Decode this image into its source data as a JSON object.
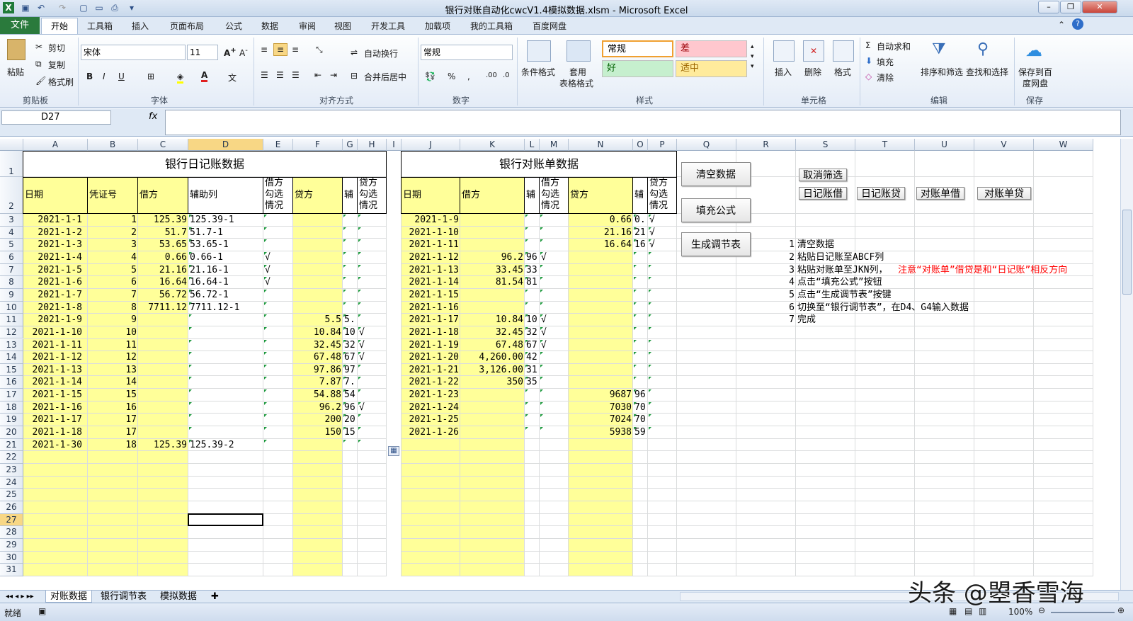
{
  "window": {
    "title": "银行对账自动化cwcV1.4模拟数据.xlsm - Microsoft Excel"
  },
  "quick_access": [
    "save-icon",
    "undo-icon",
    "redo-icon",
    "new-icon",
    "open-icon",
    "print-preview-icon"
  ],
  "tabs": {
    "file": "文件",
    "items": [
      "开始",
      "工具箱",
      "插入",
      "页面布局",
      "公式",
      "数据",
      "审阅",
      "视图",
      "开发工具",
      "加载项",
      "我的工具箱",
      "百度网盘"
    ]
  },
  "ribbon": {
    "clipboard": {
      "paste": "粘贴",
      "cut": "剪切",
      "copy": "复制",
      "format_painter": "格式刷",
      "label": "剪贴板"
    },
    "font": {
      "name": "宋体",
      "size": "11",
      "label": "字体"
    },
    "alignment": {
      "wrap": "自动换行",
      "merge": "合并后居中",
      "label": "对齐方式"
    },
    "number": {
      "format": "常规",
      "label": "数字"
    },
    "styles": {
      "conditional": "条件格式",
      "table": "套用",
      "table2": "表格格式",
      "normal": "常规",
      "bad": "差",
      "good": "好",
      "neutral": "适中",
      "label": "样式"
    },
    "cells": {
      "insert": "插入",
      "delete": "删除",
      "format": "格式",
      "label": "单元格"
    },
    "editing": {
      "autosum": "自动求和",
      "fill": "填充",
      "clear": "清除",
      "sort": "排序和筛选",
      "find": "查找和选择",
      "label": "编辑"
    },
    "save": {
      "button": "保存到百",
      "button2": "度网盘",
      "label": "保存"
    }
  },
  "formula_bar": {
    "name_box": "D27",
    "fx": "fx",
    "formula": ""
  },
  "columns": [
    "A",
    "B",
    "C",
    "D",
    "E",
    "F",
    "G",
    "H",
    "I",
    "J",
    "K",
    "L",
    "M",
    "N",
    "O",
    "P",
    "Q",
    "R",
    "S",
    "T",
    "U",
    "V",
    "W"
  ],
  "rows": [
    "1",
    "2",
    "3",
    "4",
    "5",
    "6",
    "7",
    "8",
    "9",
    "10",
    "11",
    "12",
    "13",
    "14",
    "15",
    "16",
    "17",
    "18",
    "19",
    "20",
    "21",
    "22",
    "23",
    "24",
    "25",
    "26",
    "27",
    "28",
    "29",
    "30",
    "31"
  ],
  "journal": {
    "title": "银行日记账数据",
    "headers": {
      "date": "日期",
      "voucher": "凭证号",
      "debit": "借方",
      "aux": "辅助列",
      "debit_check": "借方勾选情况",
      "credit": "贷方",
      "aux2": "辅",
      "credit_check": "贷方勾选情况"
    },
    "rows": [
      {
        "date": "2021-1-1",
        "voucher": "1",
        "debit": "125.39",
        "aux": "125.39-1",
        "dchk": "",
        "credit": "",
        "aux2": "",
        "cchk": ""
      },
      {
        "date": "2021-1-2",
        "voucher": "2",
        "debit": "51.7",
        "aux": "51.7-1",
        "dchk": "",
        "credit": "",
        "aux2": "",
        "cchk": ""
      },
      {
        "date": "2021-1-3",
        "voucher": "3",
        "debit": "53.65",
        "aux": "53.65-1",
        "dchk": "",
        "credit": "",
        "aux2": "",
        "cchk": ""
      },
      {
        "date": "2021-1-4",
        "voucher": "4",
        "debit": "0.66",
        "aux": "0.66-1",
        "dchk": "√",
        "credit": "",
        "aux2": "",
        "cchk": ""
      },
      {
        "date": "2021-1-5",
        "voucher": "5",
        "debit": "21.16",
        "aux": "21.16-1",
        "dchk": "√",
        "credit": "",
        "aux2": "",
        "cchk": ""
      },
      {
        "date": "2021-1-6",
        "voucher": "6",
        "debit": "16.64",
        "aux": "16.64-1",
        "dchk": "√",
        "credit": "",
        "aux2": "",
        "cchk": ""
      },
      {
        "date": "2021-1-7",
        "voucher": "7",
        "debit": "56.72",
        "aux": "56.72-1",
        "dchk": "",
        "credit": "",
        "aux2": "",
        "cchk": ""
      },
      {
        "date": "2021-1-8",
        "voucher": "8",
        "debit": "7711.12",
        "aux": "7711.12-1",
        "dchk": "",
        "credit": "",
        "aux2": "",
        "cchk": ""
      },
      {
        "date": "2021-1-9",
        "voucher": "9",
        "debit": "",
        "aux": "",
        "dchk": "",
        "credit": "5.5",
        "aux2": "5.",
        "cchk": ""
      },
      {
        "date": "2021-1-10",
        "voucher": "10",
        "debit": "",
        "aux": "",
        "dchk": "",
        "credit": "10.84",
        "aux2": "10.",
        "cchk": "√"
      },
      {
        "date": "2021-1-11",
        "voucher": "11",
        "debit": "",
        "aux": "",
        "dchk": "",
        "credit": "32.45",
        "aux2": "32.",
        "cchk": "√"
      },
      {
        "date": "2021-1-12",
        "voucher": "12",
        "debit": "",
        "aux": "",
        "dchk": "",
        "credit": "67.48",
        "aux2": "67.",
        "cchk": "√"
      },
      {
        "date": "2021-1-13",
        "voucher": "13",
        "debit": "",
        "aux": "",
        "dchk": "",
        "credit": "97.86",
        "aux2": "97.",
        "cchk": ""
      },
      {
        "date": "2021-1-14",
        "voucher": "14",
        "debit": "",
        "aux": "",
        "dchk": "",
        "credit": "7.87",
        "aux2": "7.",
        "cchk": ""
      },
      {
        "date": "2021-1-15",
        "voucher": "15",
        "debit": "",
        "aux": "",
        "dchk": "",
        "credit": "54.88",
        "aux2": "54.",
        "cchk": ""
      },
      {
        "date": "2021-1-16",
        "voucher": "16",
        "debit": "",
        "aux": "",
        "dchk": "",
        "credit": "96.2",
        "aux2": "96.",
        "cchk": "√"
      },
      {
        "date": "2021-1-17",
        "voucher": "17",
        "debit": "",
        "aux": "",
        "dchk": "",
        "credit": "200",
        "aux2": "20",
        "cchk": ""
      },
      {
        "date": "2021-1-18",
        "voucher": "17",
        "debit": "",
        "aux": "",
        "dchk": "",
        "credit": "150",
        "aux2": "15",
        "cchk": ""
      },
      {
        "date": "2021-1-30",
        "voucher": "18",
        "debit": "125.39",
        "aux": "125.39-2",
        "dchk": "",
        "credit": "",
        "aux2": "",
        "cchk": ""
      }
    ]
  },
  "statement": {
    "title": "银行对账单数据",
    "headers": {
      "date": "日期",
      "debit": "借方",
      "aux": "辅",
      "debit_check": "借方勾选情况",
      "credit": "贷方",
      "aux2": "辅",
      "credit_check": "贷方勾选情况"
    },
    "rows": [
      {
        "date": "2021-1-9",
        "debit": "",
        "aux": "",
        "dchk": "",
        "credit": "0.66",
        "aux2": "0.",
        "cchk": "√"
      },
      {
        "date": "2021-1-10",
        "debit": "",
        "aux": "",
        "dchk": "",
        "credit": "21.16",
        "aux2": "21.",
        "cchk": "√"
      },
      {
        "date": "2021-1-11",
        "debit": "",
        "aux": "",
        "dchk": "",
        "credit": "16.64",
        "aux2": "16.",
        "cchk": "√"
      },
      {
        "date": "2021-1-12",
        "debit": "96.2",
        "aux": "96.",
        "dchk": "√",
        "credit": "",
        "aux2": "",
        "cchk": ""
      },
      {
        "date": "2021-1-13",
        "debit": "33.45",
        "aux": "33.",
        "dchk": "",
        "credit": "",
        "aux2": "",
        "cchk": ""
      },
      {
        "date": "2021-1-14",
        "debit": "81.54",
        "aux": "81.",
        "dchk": "",
        "credit": "",
        "aux2": "",
        "cchk": ""
      },
      {
        "date": "2021-1-15",
        "debit": "",
        "aux": "",
        "dchk": "",
        "credit": "",
        "aux2": "",
        "cchk": ""
      },
      {
        "date": "2021-1-16",
        "debit": "",
        "aux": "",
        "dchk": "",
        "credit": "",
        "aux2": "",
        "cchk": ""
      },
      {
        "date": "2021-1-17",
        "debit": "10.84",
        "aux": "10.",
        "dchk": "√",
        "credit": "",
        "aux2": "",
        "cchk": ""
      },
      {
        "date": "2021-1-18",
        "debit": "32.45",
        "aux": "32.",
        "dchk": "√",
        "credit": "",
        "aux2": "",
        "cchk": ""
      },
      {
        "date": "2021-1-19",
        "debit": "67.48",
        "aux": "67.",
        "dchk": "√",
        "credit": "",
        "aux2": "",
        "cchk": ""
      },
      {
        "date": "2021-1-20",
        "debit": "4,260.00",
        "aux": "42",
        "dchk": "",
        "credit": "",
        "aux2": "",
        "cchk": ""
      },
      {
        "date": "2021-1-21",
        "debit": "3,126.00",
        "aux": "31.",
        "dchk": "",
        "credit": "",
        "aux2": "",
        "cchk": ""
      },
      {
        "date": "2021-1-22",
        "debit": "350",
        "aux": "35",
        "dchk": "",
        "credit": "",
        "aux2": "",
        "cchk": ""
      },
      {
        "date": "2021-1-23",
        "debit": "",
        "aux": "",
        "dchk": "",
        "credit": "9687",
        "aux2": "96",
        "cchk": ""
      },
      {
        "date": "2021-1-24",
        "debit": "",
        "aux": "",
        "dchk": "",
        "credit": "7030",
        "aux2": "70.",
        "cchk": ""
      },
      {
        "date": "2021-1-25",
        "debit": "",
        "aux": "",
        "dchk": "",
        "credit": "7024",
        "aux2": "70.",
        "cchk": ""
      },
      {
        "date": "2021-1-26",
        "debit": "",
        "aux": "",
        "dchk": "",
        "credit": "5938",
        "aux2": "59.",
        "cchk": ""
      }
    ]
  },
  "macro_buttons": {
    "clear": "清空数据",
    "fill": "填充公式",
    "generate": "生成调节表",
    "cancel_filter": "取消筛选",
    "journal_debit": "日记账借",
    "journal_credit": "日记账贷",
    "statement_debit": "对账单借",
    "statement_credit": "对账单贷"
  },
  "instructions": [
    {
      "num": "1",
      "text": "清空数据",
      "warn": ""
    },
    {
      "num": "2",
      "text": "粘贴日记账至ABCF列",
      "warn": ""
    },
    {
      "num": "3",
      "text": "粘贴对账单至JKN列，",
      "warn": "注意“对账单”借贷是和“日记账”相反方向"
    },
    {
      "num": "4",
      "text": "点击“填充公式”按钮",
      "warn": ""
    },
    {
      "num": "5",
      "text": "点击“生成调节表”按键",
      "warn": ""
    },
    {
      "num": "6",
      "text": "切换至“银行调节表”，在D4、G4输入数据",
      "warn": ""
    },
    {
      "num": "7",
      "text": "完成",
      "warn": ""
    }
  ],
  "sheet_tabs": [
    "对账数据",
    "银行调节表",
    "模拟数据"
  ],
  "status": {
    "ready": "就绪",
    "zoom": "100%"
  },
  "watermark": "头条 @曌香雪海",
  "colors": {
    "highlight": "#ffff99",
    "excel_green": "#2a7a3c",
    "warn_red": "#ff0000"
  }
}
